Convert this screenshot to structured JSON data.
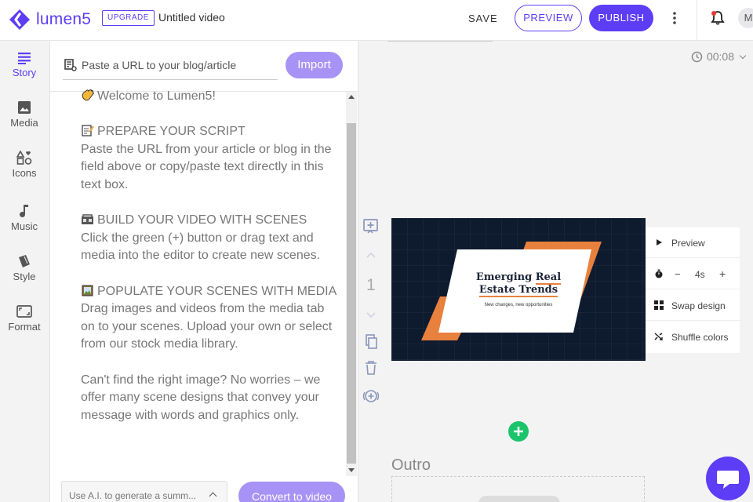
{
  "header": {
    "logo_text": "lumen5",
    "upgrade_label": "UPGRADE",
    "video_title": "Untitled video",
    "save_label": "SAVE",
    "preview_label": "PREVIEW",
    "publish_label": "PUBLISH",
    "avatar_initial": "M"
  },
  "sidebar": {
    "items": [
      {
        "label": "Story",
        "icon": "story-icon",
        "active": true
      },
      {
        "label": "Media",
        "icon": "image-icon"
      },
      {
        "label": "Icons",
        "icon": "shapes-icon"
      },
      {
        "label": "Music",
        "icon": "music-note-icon"
      },
      {
        "label": "Style",
        "icon": "brush-icon"
      },
      {
        "label": "Format",
        "icon": "aspect-ratio-icon"
      }
    ]
  },
  "story": {
    "url_placeholder": "Paste a URL to your blog/article",
    "import_label": "Import",
    "paragraphs": [
      "Welcome to Lumen5!",
      "PREPARE YOUR SCRIPT",
      "Paste the URL from your article or blog in the field above or copy/paste text directly in this text box.",
      "BUILD YOUR VIDEO WITH SCENES",
      "Click the green (+) button or drag text and media into the editor to create new scenes.",
      "POPULATE YOUR SCENES WITH MEDIA",
      "Drag images and videos from the media tab on to your scenes. Upload your own or select from our stock media library.",
      "Can't find the right image? No worries – we offer many scene designs that convey your message with words and graphics only."
    ],
    "ai_select_value": "Use A.I. to generate a summ...",
    "convert_label": "Convert to video"
  },
  "editor": {
    "duration": "00:08",
    "scene_number": "1",
    "scene": {
      "title_line1_a": "Emerging ",
      "title_line1_b": "Real",
      "title_line2": "Estate Trends",
      "subtitle": "New changes, new opportunities"
    },
    "scene_menu": {
      "preview_label": "Preview",
      "duration_minus": "−",
      "duration_value": "4s",
      "duration_plus": "+",
      "swap_label": "Swap design",
      "shuffle_label": "Shuffle colors"
    },
    "outro_label": "Outro"
  },
  "colors": {
    "brand": "#5d3df5",
    "brand_light": "#a793f5",
    "add_green": "#1bc46a",
    "scene_bg": "#0e1a2e",
    "scene_accent": "#e8813e"
  }
}
